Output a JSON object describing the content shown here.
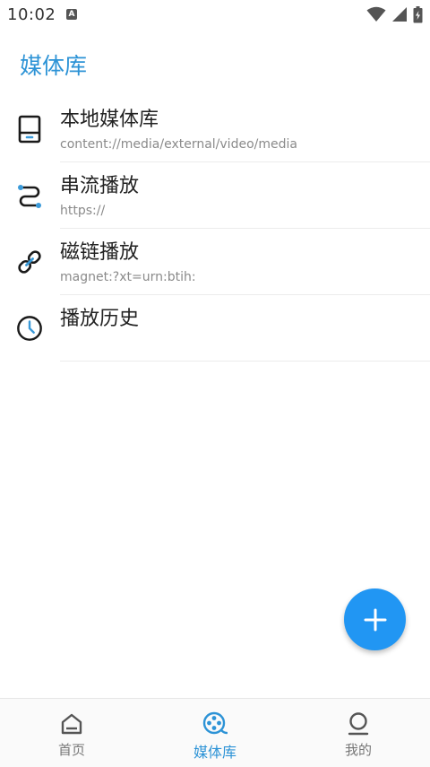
{
  "status_bar": {
    "time": "10:02",
    "notification_letter": "A",
    "icons": [
      "wifi-icon",
      "signal-icon",
      "battery-icon"
    ]
  },
  "header": {
    "title": "媒体库"
  },
  "list": [
    {
      "title": "本地媒体库",
      "subtitle": "content://media/external/video/media",
      "icon": "storage-device-icon"
    },
    {
      "title": "串流播放",
      "subtitle": "https://",
      "icon": "stream-path-icon"
    },
    {
      "title": "磁链播放",
      "subtitle": "magnet:?xt=urn:btih:",
      "icon": "magnet-link-icon"
    },
    {
      "title": "播放历史",
      "subtitle": "",
      "icon": "history-clock-icon"
    }
  ],
  "fab": {
    "icon": "plus-icon"
  },
  "bottom_nav": {
    "items": [
      {
        "label": "首页",
        "icon": "home-icon",
        "active": false
      },
      {
        "label": "媒体库",
        "icon": "film-reel-icon",
        "active": true
      },
      {
        "label": "我的",
        "icon": "person-icon",
        "active": false
      }
    ]
  },
  "colors": {
    "accent": "#2d93d6",
    "fab": "#2196f3",
    "icon_dark": "#1a1a1a",
    "icon_blue": "#3a9ad9"
  }
}
